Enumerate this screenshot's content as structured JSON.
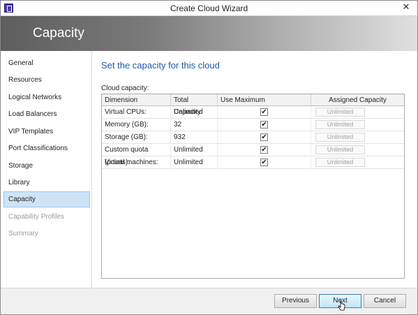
{
  "window": {
    "title": "Create Cloud Wizard",
    "close_glyph": "✕"
  },
  "banner": {
    "title": "Capacity"
  },
  "sidebar": {
    "items": [
      {
        "label": "General",
        "state": "normal"
      },
      {
        "label": "Resources",
        "state": "normal"
      },
      {
        "label": "Logical Networks",
        "state": "normal"
      },
      {
        "label": "Load Balancers",
        "state": "normal"
      },
      {
        "label": "VIP Templates",
        "state": "normal"
      },
      {
        "label": "Port Classifications",
        "state": "normal"
      },
      {
        "label": "Storage",
        "state": "normal"
      },
      {
        "label": "Library",
        "state": "normal"
      },
      {
        "label": "Capacity",
        "state": "active"
      },
      {
        "label": "Capability Profiles",
        "state": "disabled"
      },
      {
        "label": "Summary",
        "state": "disabled"
      }
    ]
  },
  "main": {
    "heading": "Set the capacity for this cloud",
    "section_label": "Cloud capacity:",
    "table": {
      "headers": [
        "Dimension",
        "Total Capacity",
        "Use Maximum",
        "Assigned Capacity"
      ],
      "rows": [
        {
          "dimension": "Virtual CPUs:",
          "total": "Unlimited",
          "use_max": "✔",
          "assigned": "Unlimited"
        },
        {
          "dimension": "Memory (GB):",
          "total": "32",
          "use_max": "✔",
          "assigned": "Unlimited"
        },
        {
          "dimension": "Storage (GB):",
          "total": "932",
          "use_max": "✔",
          "assigned": "Unlimited"
        },
        {
          "dimension": "Custom quota (points):",
          "total": "Unlimited",
          "use_max": "✔",
          "assigned": "Unlimited"
        },
        {
          "dimension": "Virtual machines:",
          "total": "Unlimited",
          "use_max": "✔",
          "assigned": "Unlimited"
        }
      ]
    }
  },
  "footer": {
    "previous_label": "Previous",
    "next_label": "Next",
    "cancel_label": "Cancel"
  },
  "colors": {
    "heading": "#1d5aa6",
    "active_nav_bg": "#cfe3f7",
    "banner_dark": "#5e5e5e"
  }
}
